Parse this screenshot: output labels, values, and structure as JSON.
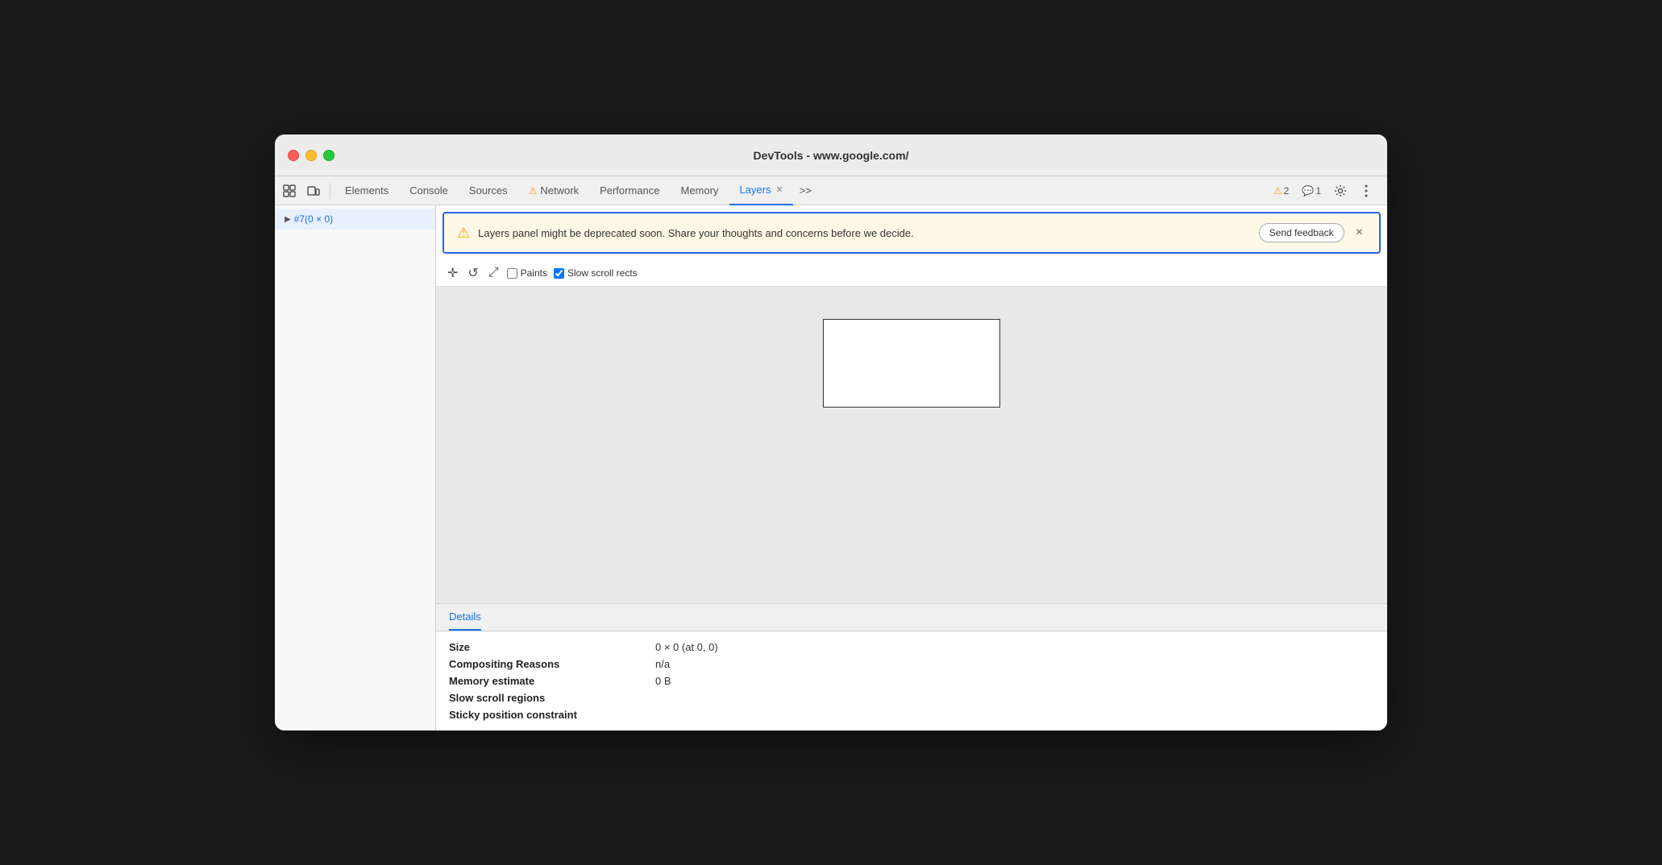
{
  "window": {
    "title": "DevTools - www.google.com/"
  },
  "toolbar": {
    "tabs": [
      {
        "id": "elements",
        "label": "Elements",
        "active": false,
        "warning": false
      },
      {
        "id": "console",
        "label": "Console",
        "active": false,
        "warning": false
      },
      {
        "id": "sources",
        "label": "Sources",
        "active": false,
        "warning": false
      },
      {
        "id": "network",
        "label": "Network",
        "active": false,
        "warning": true
      },
      {
        "id": "performance",
        "label": "Performance",
        "active": false,
        "warning": false
      },
      {
        "id": "memory",
        "label": "Memory",
        "active": false,
        "warning": false
      },
      {
        "id": "layers",
        "label": "Layers",
        "active": true,
        "warning": false
      }
    ],
    "more_tabs": ">>",
    "warning_count": "2",
    "info_count": "1"
  },
  "banner": {
    "text": "Layers panel might be deprecated soon. Share your thoughts and concerns before we decide.",
    "button_label": "Send feedback",
    "close_label": "×"
  },
  "layers_toolbar": {
    "paints_label": "Paints",
    "slow_scroll_label": "Slow scroll rects",
    "paints_checked": false,
    "slow_scroll_checked": true
  },
  "sidebar": {
    "items": [
      {
        "id": "layer1",
        "label": "#7(0 × 0)",
        "active": true
      }
    ]
  },
  "details": {
    "tab_label": "Details",
    "rows": [
      {
        "label": "Size",
        "value": "0 × 0 (at 0, 0)"
      },
      {
        "label": "Compositing Reasons",
        "value": "n/a"
      },
      {
        "label": "Memory estimate",
        "value": "0 B"
      },
      {
        "label": "Slow scroll regions",
        "value": ""
      },
      {
        "label": "Sticky position constraint",
        "value": ""
      }
    ]
  }
}
